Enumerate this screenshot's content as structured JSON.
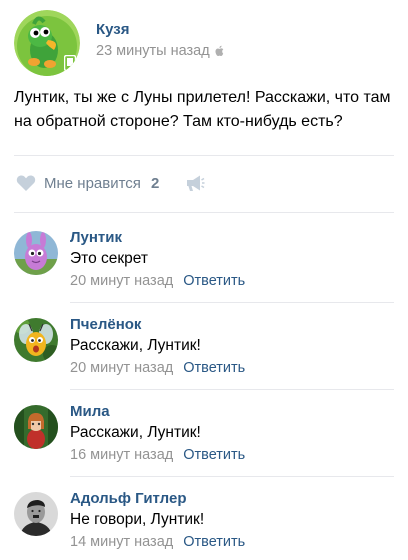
{
  "post": {
    "author": "Кузя",
    "time": "23 минуты назад",
    "platform_icon": "apple-icon",
    "text": "Лунтик, ты же с Луны прилетел! Расскажи, что там на обратной стороне? Там кто-нибудь есть?",
    "like_label": "Мне нравится",
    "like_count": "2"
  },
  "comments": [
    {
      "name": "Лунтик",
      "text": "Это секрет",
      "time": "20 минут назад",
      "reply": "Ответить"
    },
    {
      "name": "Пчелёнок",
      "text": "Расскажи, Лунтик!",
      "time": "20 минут назад",
      "reply": "Ответить"
    },
    {
      "name": "Мила",
      "text": "Расскажи, Лунтик!",
      "time": "16 минут назад",
      "reply": "Ответить"
    },
    {
      "name": "Адольф Гитлер",
      "text": "Не говори, Лунтик!",
      "time": "14 минут назад",
      "reply": "Ответить"
    }
  ],
  "colors": {
    "link": "#2a5885",
    "meta": "#939393",
    "like": "#6f7f90",
    "divider": "#e7e8ec"
  }
}
